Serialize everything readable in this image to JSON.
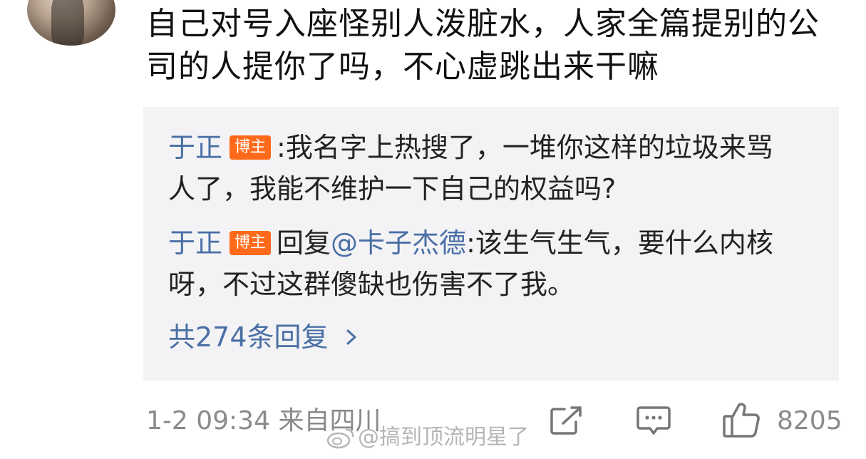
{
  "comment": {
    "text": "自己对号入座怪别人泼脏水，人家全篇提别的公司的人提你了吗，不心虚跳出来干嘛"
  },
  "replies": [
    {
      "author": "于正",
      "badge": "博主",
      "sep": ":",
      "prefix": "",
      "mention": "",
      "text": "我名字上热搜了，一堆你这样的垃圾来骂人了，我能不维护一下自己的权益吗?"
    },
    {
      "author": "于正",
      "badge": "博主",
      "sep": "",
      "prefix": "回复",
      "mention": "@卡子杰德",
      "text": ":该生气生气，要什么内核呀，不过这群傻缺也伤害不了我。"
    }
  ],
  "more_replies": "共274条回复",
  "footer": {
    "timestamp": "1-2 09:34",
    "location": "来自四川",
    "like_count": "8205"
  },
  "watermark": "@搞到顶流明星了",
  "icons": {
    "share": "share-icon",
    "comment": "comment-icon",
    "like": "thumbs-up-icon",
    "more": "chevron-right-icon"
  },
  "colors": {
    "author": "#4a6fa5",
    "badge": "#ff6a1a",
    "reply_bg": "#f3f3f5",
    "meta": "#8a8a8a"
  }
}
